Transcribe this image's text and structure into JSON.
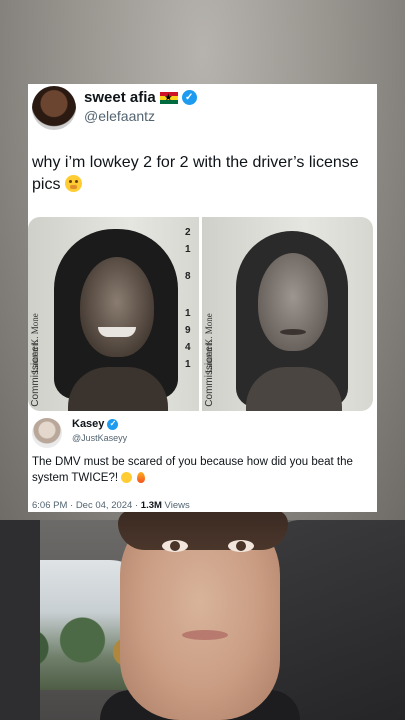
{
  "tweet": {
    "author": {
      "name": "sweet afia",
      "handle": "@elefaantz",
      "flag": "ghana-flag-icon",
      "verified": true
    },
    "text": "why i’m lowkey 2 for 2 with the driver’s license pics",
    "emoji": "hand-over-mouth-emoji",
    "photos": [
      {
        "label": "Commissioner:",
        "signature": "Lauren K. Mone",
        "digits": [
          "2",
          "1",
          "8",
          "1",
          "9",
          "4",
          "1"
        ]
      },
      {
        "label": "Commissioner:",
        "signature": "Lauren K. Mone",
        "digits": []
      }
    ]
  },
  "quote": {
    "name": "Kasey",
    "handle": "@JustKaseyy",
    "verified": true,
    "text": "The DMV must be scared of you because how did you beat the system TWICE?!",
    "emojis": [
      "starstruck-emoji",
      "fire-emoji"
    ],
    "time": "6:06 PM · Dec 04, 2024 ·",
    "views_count": "1.3M",
    "views_label": "Views"
  },
  "colors": {
    "verified": "#1d9bf0",
    "text": "#0f1419",
    "muted": "#536471"
  }
}
